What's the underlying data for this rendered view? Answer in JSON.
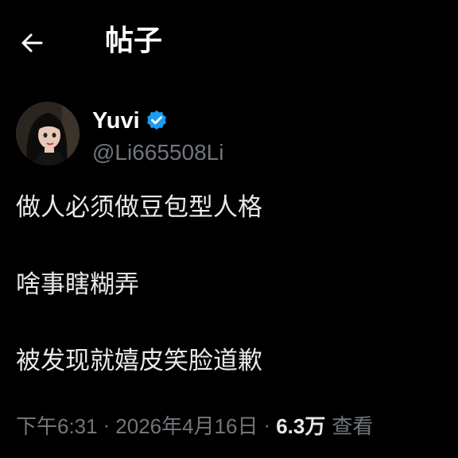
{
  "header": {
    "back_icon": "arrow-left-icon",
    "title": "帖子"
  },
  "author": {
    "display_name": "Yuvi",
    "verified_icon": "verified-badge-icon",
    "verified_color": "#1d9bf0",
    "handle": "@Li665508Li"
  },
  "post": {
    "lines": [
      "做人必须做豆包型人格",
      "啥事瞎糊弄",
      "被发现就嬉皮笑脸道歉"
    ]
  },
  "meta": {
    "time": "下午6:31",
    "separator": "·",
    "date": "2026年4月16日",
    "views_count": "6.3万",
    "views_label": "查看"
  },
  "colors": {
    "background": "#000000",
    "primary_text": "#e7e9ea",
    "secondary_text": "#71767b",
    "accent": "#1d9bf0"
  }
}
